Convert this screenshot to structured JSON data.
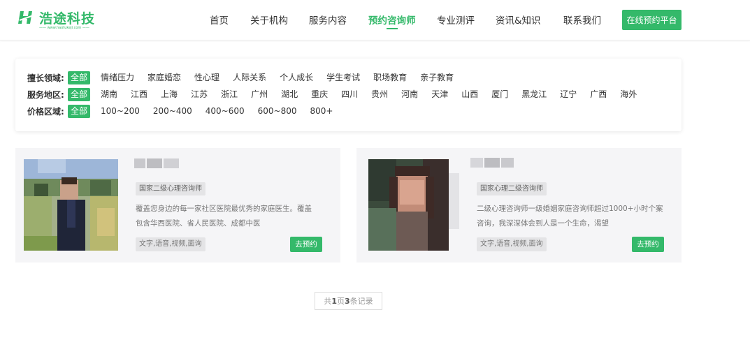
{
  "brand": {
    "name": "浩途科技",
    "url": "www.haotukeji.com",
    "accent": "#34b96a"
  },
  "nav": {
    "items": [
      {
        "label": "首页",
        "active": false
      },
      {
        "label": "关于机构",
        "active": false
      },
      {
        "label": "服务内容",
        "active": false
      },
      {
        "label": "预约咨询师",
        "active": true
      },
      {
        "label": "专业测评",
        "active": false
      },
      {
        "label": "资讯&知识",
        "active": false
      },
      {
        "label": "联系我们",
        "active": false
      }
    ],
    "cta_label": "在线预约平台"
  },
  "filters": {
    "domain": {
      "label": "擅长领域:",
      "options": [
        "全部",
        "情绪压力",
        "家庭婚恋",
        "性心理",
        "人际关系",
        "个人成长",
        "学生考试",
        "职场教育",
        "亲子教育"
      ],
      "selected": "全部"
    },
    "region": {
      "label": "服务地区:",
      "options": [
        "全部",
        "湖南",
        "江西",
        "上海",
        "江苏",
        "浙江",
        "广州",
        "湖北",
        "重庆",
        "四川",
        "贵州",
        "河南",
        "天津",
        "山西",
        "厦门",
        "黑龙江",
        "辽宁",
        "广西",
        "海外"
      ],
      "selected": "全部"
    },
    "price": {
      "label": "价格区域:",
      "options": [
        "全部",
        "100~200",
        "200~400",
        "400~600",
        "600~800",
        "800+"
      ],
      "selected": "全部"
    }
  },
  "counselors": [
    {
      "title": "国家二级心理咨询师",
      "description": "覆盖您身边的每一家社区医院最优秀的家庭医生。覆盖包含华西医院、省人民医院、成都中医",
      "services": "文字,语音,视频,面询",
      "book_label": "去预约"
    },
    {
      "title": "国家心理二级咨询师",
      "description": "二级心理咨询师一级婚姻家庭咨询师超过1000+小时个案咨询，我深深体会到人是一个生命，渴望",
      "services": "文字,语音,视频,面询",
      "book_label": "去预约"
    }
  ],
  "pagination": {
    "prefix": "共 ",
    "pages": "1",
    "mid": "页",
    "records": "3",
    "suffix": "条记录"
  }
}
